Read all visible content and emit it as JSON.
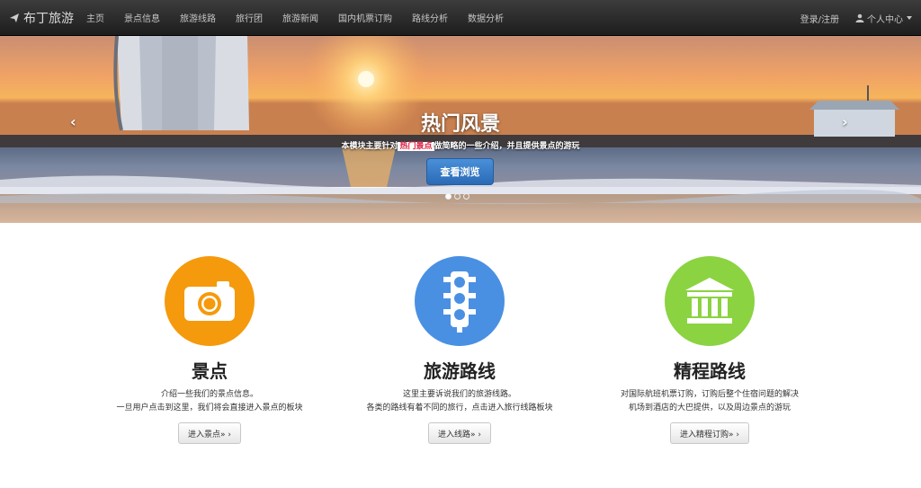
{
  "navbar": {
    "brand": "布丁旅游",
    "items": [
      "主页",
      "景点信息",
      "旅游线路",
      "旅行团",
      "旅游新闻",
      "国内机票订购",
      "路线分析",
      "数据分析"
    ],
    "login": "登录/注册",
    "user_menu": "个人中心"
  },
  "hero": {
    "title": "热门风景",
    "desc_before": "本模块主要针对",
    "desc_highlight": "热门景点",
    "desc_after": "做简略的一些介绍，并且提供景点的游玩",
    "button": "查看浏览",
    "prev_arrow": "‹",
    "next_arrow": "›",
    "slide_count": 3,
    "active_slide": 1
  },
  "features": [
    {
      "title": "景点",
      "desc_line1": "介绍一些我们的景点信息。",
      "desc_line2": "一旦用户点击到这里，我们将会直接进入景点的板块",
      "button": "进入景点» ›",
      "color": "#f59a0c",
      "icon": "camera-icon"
    },
    {
      "title": "旅游路线",
      "desc_line1": "这里主要诉说我们的旅游线路。",
      "desc_line2": "各类的路线有着不同的旅行，点击进入旅行线路板块",
      "button": "进入线路» ›",
      "color": "#4a90e2",
      "icon": "traffic-light-icon"
    },
    {
      "title": "精程路线",
      "desc_line1": "对国际航班机票订购，订购后整个住宿问题的解决",
      "desc_line2": "机场到酒店的大巴提供，以及周边景点的游玩",
      "button": "进入精程订购» ›",
      "color": "#8bd341",
      "icon": "bank-icon"
    }
  ]
}
